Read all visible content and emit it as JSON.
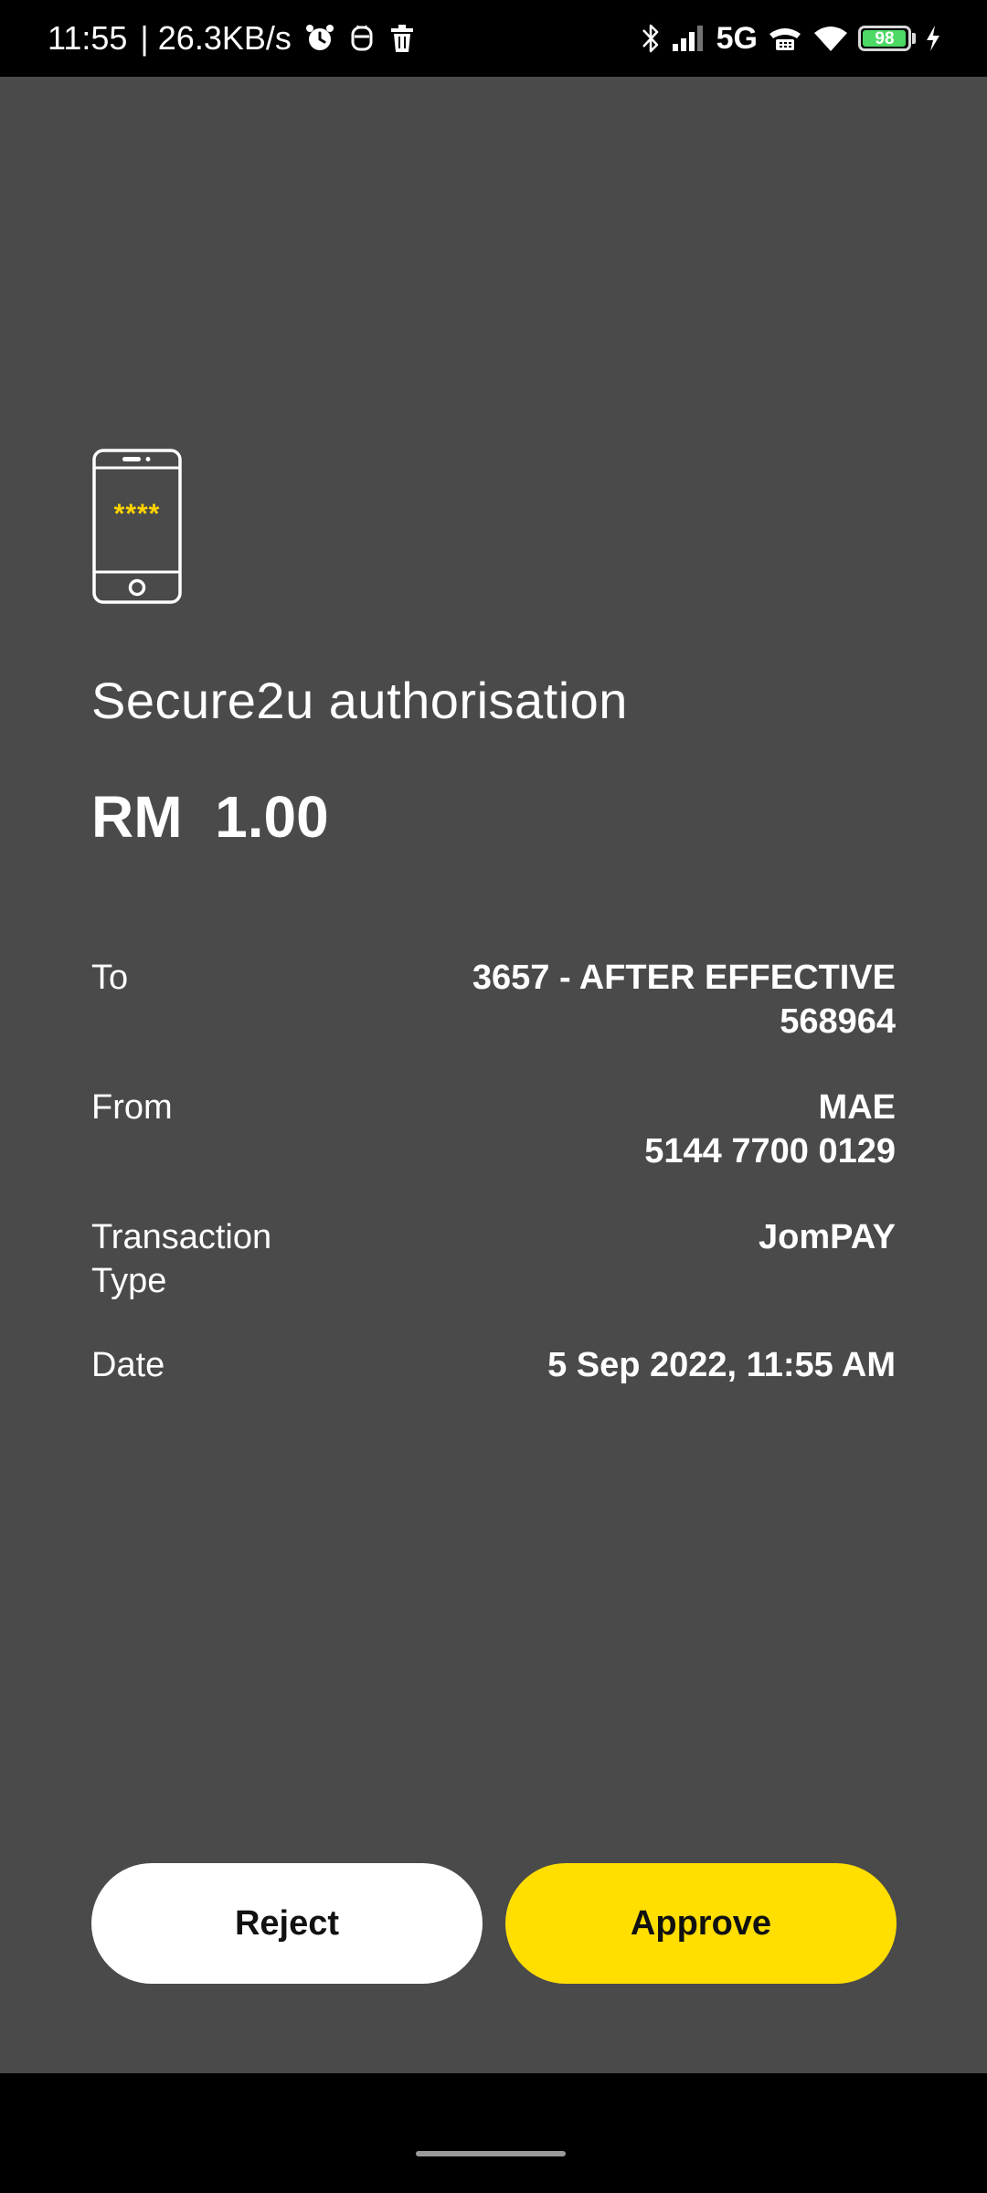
{
  "status_bar": {
    "time": "11:55",
    "network_speed": "| 26.3KB/s",
    "network_type": "5G",
    "battery_level": "98",
    "battery_fraction": 0.98,
    "icons": [
      "alarm-icon",
      "app-notification-icon",
      "delete-icon",
      "bluetooth-icon",
      "signal-icon",
      "hd-voice-icon",
      "wifi-icon",
      "battery-icon",
      "charging-icon"
    ]
  },
  "auth": {
    "icon": "phone-pin-icon",
    "pin_mask": "****",
    "title": "Secure2u authorisation",
    "amount": "RM  1.00",
    "details": [
      {
        "label": "To",
        "value_lines": [
          "3657 - AFTER EFFECTIVE",
          "568964"
        ]
      },
      {
        "label": "From",
        "value_lines": [
          "MAE",
          "5144 7700 0129"
        ]
      },
      {
        "label": "Transaction Type",
        "value_lines": [
          "JomPAY"
        ]
      },
      {
        "label": "Date",
        "value_lines": [
          "5 Sep 2022, 11:55 AM"
        ]
      }
    ]
  },
  "actions": {
    "reject_label": "Reject",
    "approve_label": "Approve"
  },
  "colors": {
    "background": "#4a4a4a",
    "accent": "#ffde00",
    "pin_mask": "#ffd400",
    "battery": "#4cd964"
  }
}
